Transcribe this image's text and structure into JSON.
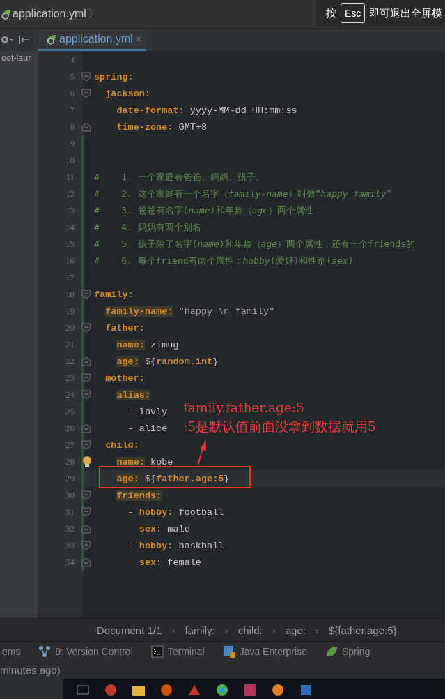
{
  "title_bar": {
    "breadcrumb": "application.yml",
    "separator": "〉"
  },
  "fullscreen_hint": {
    "before": "按",
    "key": "Esc",
    "after": "即可退出全屏模"
  },
  "project_panel": {
    "label": "oot-laur"
  },
  "tabs": [
    {
      "label": "application.yml",
      "close": "×",
      "selected": true
    }
  ],
  "editor": {
    "lines": [
      {
        "number": "4"
      },
      {
        "number": "5",
        "fold_start": true,
        "tokens": [
          {
            "kind": "key",
            "text": "spring:"
          }
        ]
      },
      {
        "number": "6",
        "fold_start": true,
        "tokens": [
          {
            "kind": "key",
            "text": "  jackson:"
          }
        ]
      },
      {
        "number": "7",
        "tokens": [
          {
            "kind": "key",
            "text": "    date-format:"
          },
          {
            "kind": "value",
            "text": " yyyy-MM-dd HH:mm:ss"
          }
        ]
      },
      {
        "number": "8",
        "fold_end": true,
        "tokens": [
          {
            "kind": "key",
            "text": "    time-zone:"
          },
          {
            "kind": "value",
            "text": " GMT+8"
          }
        ]
      },
      {
        "number": "9",
        "modified": true
      },
      {
        "number": "10",
        "modified": true
      },
      {
        "number": "11",
        "modified": true,
        "tokens": [
          {
            "kind": "comment",
            "text": "#    1. 一个家庭有爸爸、妈妈、孩子。"
          }
        ]
      },
      {
        "number": "12",
        "modified": true,
        "tokens": [
          {
            "kind": "comment",
            "text": "#    2. 这个家庭有一个名字（*family-name*）叫做“*happy family*”"
          }
        ]
      },
      {
        "number": "13",
        "modified": true,
        "tokens": [
          {
            "kind": "comment",
            "text": "#    3. 爸爸有名字(*name*)和年龄（*age*）两个属性"
          }
        ]
      },
      {
        "number": "14",
        "modified": true,
        "tokens": [
          {
            "kind": "comment",
            "text": "#    4. 妈妈有两个别名"
          }
        ]
      },
      {
        "number": "15",
        "modified": true,
        "tokens": [
          {
            "kind": "comment",
            "text": "#    5. 孩子除了名字(*name*)和年龄（*age*）两个属性，还有一个friends的"
          }
        ]
      },
      {
        "number": "16",
        "modified": true,
        "tokens": [
          {
            "kind": "comment",
            "text": "#    6. 每个friend有两个属性：*hobby*(爱好)和性别(*sex*)"
          }
        ]
      },
      {
        "number": "17",
        "modified": true
      },
      {
        "number": "18",
        "modified": true,
        "fold_start": true,
        "tokens": [
          {
            "kind": "key",
            "text": "family:"
          }
        ]
      },
      {
        "number": "19",
        "modified": true,
        "tokens": [
          {
            "kind": "key",
            "highlight": true,
            "text": "  family-name:"
          },
          {
            "kind": "string",
            "text": " \"happy \\n family\""
          }
        ]
      },
      {
        "number": "20",
        "modified": true,
        "fold_start": true,
        "tokens": [
          {
            "kind": "key",
            "text": "  father:"
          }
        ]
      },
      {
        "number": "21",
        "modified": true,
        "tokens": [
          {
            "kind": "key",
            "highlight": true,
            "text": "    name:"
          },
          {
            "kind": "value",
            "text": " zimug"
          }
        ]
      },
      {
        "number": "22",
        "modified": true,
        "fold_end": true,
        "tokens": [
          {
            "kind": "key",
            "highlight": true,
            "text": "    age:"
          },
          {
            "kind": "value",
            "text": " ${"
          },
          {
            "kind": "ref",
            "text": "random.int"
          },
          {
            "kind": "value",
            "text": "}"
          }
        ]
      },
      {
        "number": "23",
        "modified": true,
        "fold_start": true,
        "tokens": [
          {
            "kind": "key",
            "text": "  mother:"
          }
        ]
      },
      {
        "number": "24",
        "modified": true,
        "fold_start": true,
        "tokens": [
          {
            "kind": "key",
            "highlight": true,
            "text": "    alias:"
          }
        ]
      },
      {
        "number": "25",
        "modified": true,
        "tokens": [
          {
            "kind": "value",
            "text": "      - lovly"
          }
        ]
      },
      {
        "number": "26",
        "modified": true,
        "fold_end": true,
        "tokens": [
          {
            "kind": "value",
            "text": "      - alice"
          }
        ]
      },
      {
        "number": "27",
        "modified": true,
        "fold_start": true,
        "tokens": [
          {
            "kind": "key",
            "text": "  child:"
          }
        ]
      },
      {
        "number": "28",
        "modified": true,
        "bulb": true,
        "tokens": [
          {
            "kind": "key",
            "highlight": true,
            "text": "    name:"
          },
          {
            "kind": "value",
            "text": " kobe"
          }
        ]
      },
      {
        "number": "29",
        "modified": true,
        "current": true,
        "tokens": [
          {
            "kind": "key",
            "highlight": true,
            "text": "    age:"
          },
          {
            "kind": "value",
            "text": " ${"
          },
          {
            "kind": "ref",
            "text": "father.age:5"
          },
          {
            "kind": "value",
            "text": "}"
          }
        ]
      },
      {
        "number": "30",
        "modified": true,
        "fold_start": true,
        "tokens": [
          {
            "kind": "key",
            "highlight": true,
            "text": "    friends:"
          }
        ]
      },
      {
        "number": "31",
        "modified": true,
        "fold_start": true,
        "tokens": [
          {
            "kind": "value",
            "text": "      - "
          },
          {
            "kind": "key",
            "text": "hobby:"
          },
          {
            "kind": "value",
            "text": " football"
          }
        ]
      },
      {
        "number": "32",
        "modified": true,
        "fold_end": true,
        "tokens": [
          {
            "kind": "key",
            "text": "        sex:"
          },
          {
            "kind": "value",
            "text": " male"
          }
        ]
      },
      {
        "number": "33",
        "modified": true,
        "fold_start": true,
        "tokens": [
          {
            "kind": "value",
            "text": "      - "
          },
          {
            "kind": "key",
            "text": "hobby:"
          },
          {
            "kind": "value",
            "text": " baskball"
          }
        ]
      },
      {
        "number": "34",
        "modified": true,
        "fold_end": true,
        "tokens": [
          {
            "kind": "key",
            "text": "        sex:"
          },
          {
            "kind": "value",
            "text": " female"
          }
        ]
      }
    ]
  },
  "annotation": {
    "lines": [
      "family.father.age:5",
      ":5是默认值前面没拿到数据就用5"
    ]
  },
  "breadcrumbs": {
    "separator": "›",
    "items": [
      "Document 1/1",
      "family:",
      "child:",
      "age:",
      "${father.age:5}"
    ]
  },
  "tool_windows": [
    {
      "kind": "text",
      "label": "ems"
    },
    {
      "kind": "vcs",
      "label": "9: Version Control"
    },
    {
      "kind": "terminal",
      "label": "Terminal"
    },
    {
      "kind": "javaee",
      "label": "Java Enterprise"
    },
    {
      "kind": "spring",
      "label": "Spring"
    }
  ],
  "status_bar": {
    "text": "minutes ago)"
  }
}
